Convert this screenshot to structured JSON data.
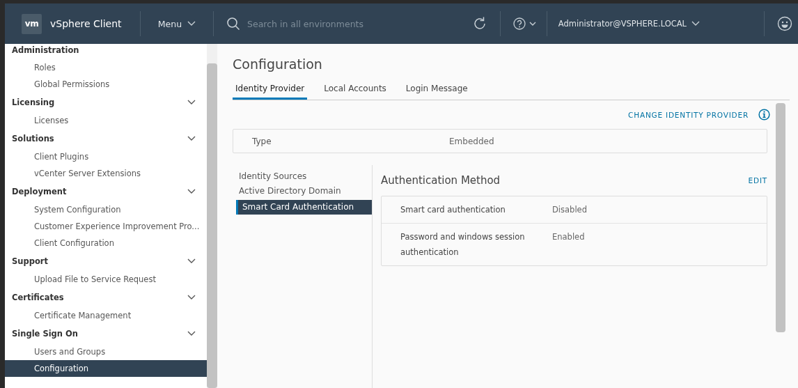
{
  "header": {
    "logo": "vm",
    "app_name": "vSphere Client",
    "menu": "Menu",
    "search": {
      "placeholder": "Search in all environments"
    },
    "user": "Administrator@VSPHERE.LOCAL"
  },
  "sidebar": {
    "groups": [
      {
        "label": "Administration",
        "collapsible": false,
        "children": [
          {
            "label": "Roles",
            "selected": false
          },
          {
            "label": "Global Permissions",
            "selected": false
          }
        ]
      },
      {
        "label": "Licensing",
        "collapsible": true,
        "children": [
          {
            "label": "Licenses",
            "selected": false
          }
        ]
      },
      {
        "label": "Solutions",
        "collapsible": true,
        "children": [
          {
            "label": "Client Plugins",
            "selected": false
          },
          {
            "label": "vCenter Server Extensions",
            "selected": false
          }
        ]
      },
      {
        "label": "Deployment",
        "collapsible": true,
        "children": [
          {
            "label": "System Configuration",
            "selected": false
          },
          {
            "label": "Customer Experience Improvement Pro...",
            "selected": false
          },
          {
            "label": "Client Configuration",
            "selected": false
          }
        ]
      },
      {
        "label": "Support",
        "collapsible": true,
        "children": [
          {
            "label": "Upload File to Service Request",
            "selected": false
          }
        ]
      },
      {
        "label": "Certificates",
        "collapsible": true,
        "children": [
          {
            "label": "Certificate Management",
            "selected": false
          }
        ]
      },
      {
        "label": "Single Sign On",
        "collapsible": true,
        "children": [
          {
            "label": "Users and Groups",
            "selected": false
          },
          {
            "label": "Configuration",
            "selected": true
          }
        ]
      }
    ]
  },
  "main": {
    "title": "Configuration",
    "tabs": [
      {
        "label": "Identity Provider",
        "selected": true
      },
      {
        "label": "Local Accounts",
        "selected": false
      },
      {
        "label": "Login Message",
        "selected": false
      }
    ],
    "action": "CHANGE IDENTITY PROVIDER",
    "type_row": {
      "label": "Type",
      "value": "Embedded"
    },
    "nav": [
      {
        "label": "Identity Sources",
        "selected": false
      },
      {
        "label": "Active Directory Domain",
        "selected": false
      },
      {
        "label": "Smart Card Authentication",
        "selected": true
      }
    ],
    "section": {
      "title": "Authentication Method",
      "action": "EDIT",
      "rows": [
        {
          "label": "Smart card authentication",
          "value": "Disabled"
        },
        {
          "label": "Password and windows session authentication",
          "value": "Enabled"
        }
      ]
    }
  }
}
